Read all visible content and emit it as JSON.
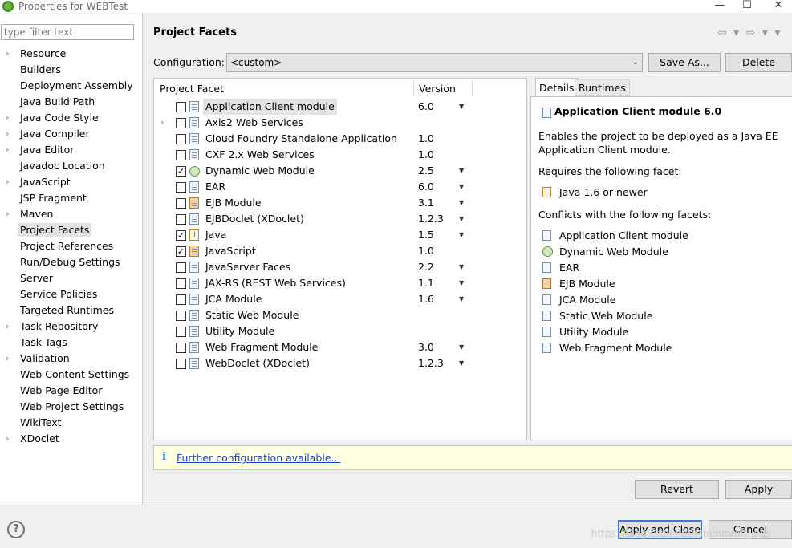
{
  "window": {
    "title": "Properties for WEBTest",
    "minimize": "—",
    "maximize": "☐",
    "close": "✕"
  },
  "sidebar": {
    "filter_placeholder": "type filter text",
    "items": [
      {
        "label": "Resource",
        "expandable": true
      },
      {
        "label": "Builders",
        "expandable": false
      },
      {
        "label": "Deployment Assembly",
        "expandable": false
      },
      {
        "label": "Java Build Path",
        "expandable": false
      },
      {
        "label": "Java Code Style",
        "expandable": true
      },
      {
        "label": "Java Compiler",
        "expandable": true
      },
      {
        "label": "Java Editor",
        "expandable": true
      },
      {
        "label": "Javadoc Location",
        "expandable": false
      },
      {
        "label": "JavaScript",
        "expandable": true
      },
      {
        "label": "JSP Fragment",
        "expandable": false
      },
      {
        "label": "Maven",
        "expandable": true
      },
      {
        "label": "Project Facets",
        "expandable": false,
        "selected": true
      },
      {
        "label": "Project References",
        "expandable": false
      },
      {
        "label": "Run/Debug Settings",
        "expandable": false
      },
      {
        "label": "Server",
        "expandable": false
      },
      {
        "label": "Service Policies",
        "expandable": false
      },
      {
        "label": "Targeted Runtimes",
        "expandable": false
      },
      {
        "label": "Task Repository",
        "expandable": true
      },
      {
        "label": "Task Tags",
        "expandable": false
      },
      {
        "label": "Validation",
        "expandable": true
      },
      {
        "label": "Web Content Settings",
        "expandable": false
      },
      {
        "label": "Web Page Editor",
        "expandable": false
      },
      {
        "label": "Web Project Settings",
        "expandable": false
      },
      {
        "label": "WikiText",
        "expandable": false
      },
      {
        "label": "XDoclet",
        "expandable": true
      }
    ]
  },
  "header": {
    "title": "Project Facets",
    "nav_icons": "⇦ ▾ ⇨ ▾ ▾"
  },
  "config": {
    "label": "Configuration:",
    "value": "<custom>",
    "save_as": "Save As...",
    "delete": "Delete"
  },
  "facets": {
    "col_facet": "Project Facet",
    "col_version": "Version",
    "rows": [
      {
        "name": "Application Client module",
        "version": "6.0",
        "checked": false,
        "dropdown": true,
        "icon": "doc",
        "expand": false,
        "highlight": true
      },
      {
        "name": "Axis2 Web Services",
        "version": "",
        "checked": false,
        "dropdown": false,
        "icon": "doc",
        "expand": true
      },
      {
        "name": "Cloud Foundry Standalone Application",
        "version": "1.0",
        "checked": false,
        "dropdown": false,
        "icon": "doc",
        "expand": false
      },
      {
        "name": "CXF 2.x Web Services",
        "version": "1.0",
        "checked": false,
        "dropdown": false,
        "icon": "doc",
        "expand": false
      },
      {
        "name": "Dynamic Web Module",
        "version": "2.5",
        "checked": true,
        "dropdown": true,
        "icon": "web",
        "expand": false
      },
      {
        "name": "EAR",
        "version": "6.0",
        "checked": false,
        "dropdown": true,
        "icon": "doc",
        "expand": false
      },
      {
        "name": "EJB Module",
        "version": "3.1",
        "checked": false,
        "dropdown": true,
        "icon": "ejb",
        "expand": false
      },
      {
        "name": "EJBDoclet (XDoclet)",
        "version": "1.2.3",
        "checked": false,
        "dropdown": true,
        "icon": "doc",
        "expand": false
      },
      {
        "name": "Java",
        "version": "1.5",
        "checked": true,
        "dropdown": true,
        "icon": "java",
        "expand": false
      },
      {
        "name": "JavaScript",
        "version": "1.0",
        "checked": true,
        "dropdown": false,
        "icon": "ejb",
        "expand": false
      },
      {
        "name": "JavaServer Faces",
        "version": "2.2",
        "checked": false,
        "dropdown": true,
        "icon": "doc",
        "expand": false
      },
      {
        "name": "JAX-RS (REST Web Services)",
        "version": "1.1",
        "checked": false,
        "dropdown": true,
        "icon": "doc",
        "expand": false
      },
      {
        "name": "JCA Module",
        "version": "1.6",
        "checked": false,
        "dropdown": true,
        "icon": "doc",
        "expand": false
      },
      {
        "name": "Static Web Module",
        "version": "",
        "checked": false,
        "dropdown": false,
        "icon": "doc",
        "expand": false
      },
      {
        "name": "Utility Module",
        "version": "",
        "checked": false,
        "dropdown": false,
        "icon": "doc",
        "expand": false
      },
      {
        "name": "Web Fragment Module",
        "version": "3.0",
        "checked": false,
        "dropdown": true,
        "icon": "doc",
        "expand": false
      },
      {
        "name": "WebDoclet (XDoclet)",
        "version": "1.2.3",
        "checked": false,
        "dropdown": true,
        "icon": "doc",
        "expand": false
      }
    ]
  },
  "details": {
    "tab_details": "Details",
    "tab_runtimes": "Runtimes",
    "title": "Application Client module 6.0",
    "description": "Enables the project to be deployed as a Java EE Application Client module.",
    "requires_label": "Requires the following facet:",
    "requires": [
      {
        "name": "Java 1.6 or newer",
        "icon": "java"
      }
    ],
    "conflicts_label": "Conflicts with the following facets:",
    "conflicts": [
      {
        "name": "Application Client module",
        "icon": "doc"
      },
      {
        "name": "Dynamic Web Module",
        "icon": "web"
      },
      {
        "name": "EAR",
        "icon": "doc"
      },
      {
        "name": "EJB Module",
        "icon": "ejb"
      },
      {
        "name": "JCA Module",
        "icon": "doc"
      },
      {
        "name": "Static Web Module",
        "icon": "doc"
      },
      {
        "name": "Utility Module",
        "icon": "doc"
      },
      {
        "name": "Web Fragment Module",
        "icon": "doc"
      }
    ]
  },
  "info": {
    "icon": "i",
    "link": "Further configuration available..."
  },
  "buttons": {
    "revert": "Revert",
    "apply": "Apply",
    "apply_close": "Apply and Close",
    "cancel": "Cancel",
    "help": "?"
  },
  "watermark": "https://blog.csdn.net/Mmmmmn_logs"
}
